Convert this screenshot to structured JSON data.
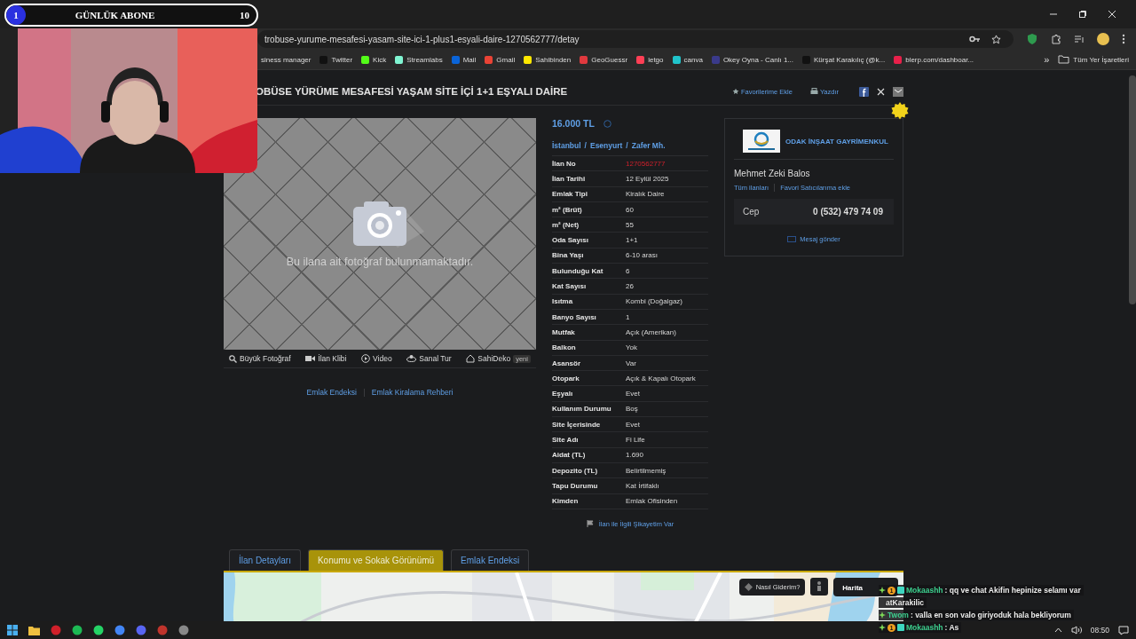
{
  "overlay": {
    "rank": "1",
    "label": "GÜNLÜK ABONE",
    "count": "10"
  },
  "browser": {
    "url": "trobuse-yurume-mesafesi-yasam-site-ici-1-plus1-esyali-daire-1270562777/detay",
    "bookmarks": [
      {
        "label": "siness manager",
        "icon": false
      },
      {
        "label": "Twitter",
        "icon": true
      },
      {
        "label": "Kick",
        "icon": true
      },
      {
        "label": "Streamlabs",
        "icon": true
      },
      {
        "label": "Mail",
        "icon": true
      },
      {
        "label": "Gmail",
        "icon": true
      },
      {
        "label": "Sahibinden",
        "icon": true
      },
      {
        "label": "GeoGuessr",
        "icon": true
      },
      {
        "label": "letgo",
        "icon": true
      },
      {
        "label": "canva",
        "icon": true
      },
      {
        "label": "Okey Oyna - Canlı 1...",
        "icon": true
      },
      {
        "label": "Kürşat Karakılıç (@k...",
        "icon": true
      },
      {
        "label": "blerp.com/dashboar...",
        "icon": true
      }
    ],
    "more": "»",
    "all_bookmarks": "Tüm Yer İşaretleri"
  },
  "listing": {
    "title": "OBÜSE YÜRÜME MESAFESİ YAŞAM SİTE İÇİ 1+1 EŞYALI DAİRE",
    "actions": [
      {
        "kind": "favorite",
        "label": "Favorilerime Ekle"
      },
      {
        "kind": "print",
        "label": "Yazdır"
      }
    ],
    "photo_message": "Bu ilana ait fotoğraf bulunmamaktadır.",
    "photo_tools": [
      {
        "kind": "zoom",
        "label": "Büyük Fotoğraf"
      },
      {
        "kind": "clip",
        "label": "İlan Klibi"
      },
      {
        "kind": "video",
        "label": "Video"
      },
      {
        "kind": "tour",
        "label": "Sanal Tur"
      },
      {
        "kind": "deko",
        "label": "SahiDeko",
        "badge": "yeni"
      }
    ],
    "links": [
      "Emlak Endeksi",
      "Emlak Kiralama Rehberi"
    ],
    "price": "16.000 TL",
    "breadcrumb": [
      "İstanbul",
      "Esenyurt",
      "Zafer Mh."
    ],
    "breadcrumb_separator": "/",
    "details": [
      {
        "kind": "id",
        "label": "İlan No",
        "value": "1270562777"
      },
      {
        "kind": "text",
        "label": "İlan Tarihi",
        "value": "12 Eylül 2025"
      },
      {
        "kind": "text",
        "label": "Emlak Tipi",
        "value": "Kiralık Daire"
      },
      {
        "kind": "text",
        "label": "m² (Brüt)",
        "value": "60"
      },
      {
        "kind": "text",
        "label": "m² (Net)",
        "value": "55"
      },
      {
        "kind": "text",
        "label": "Oda Sayısı",
        "value": "1+1"
      },
      {
        "kind": "text",
        "label": "Bina Yaşı",
        "value": "6-10 arası"
      },
      {
        "kind": "text",
        "label": "Bulunduğu Kat",
        "value": "6"
      },
      {
        "kind": "text",
        "label": "Kat Sayısı",
        "value": "26"
      },
      {
        "kind": "text",
        "label": "Isıtma",
        "value": "Kombi (Doğalgaz)"
      },
      {
        "kind": "text",
        "label": "Banyo Sayısı",
        "value": "1"
      },
      {
        "kind": "text",
        "label": "Mutfak",
        "value": "Açık (Amerikan)"
      },
      {
        "kind": "text",
        "label": "Balkon",
        "value": "Yok"
      },
      {
        "kind": "text",
        "label": "Asansör",
        "value": "Var"
      },
      {
        "kind": "text",
        "label": "Otopark",
        "value": "Açık & Kapalı Otopark"
      },
      {
        "kind": "text",
        "label": "Eşyalı",
        "value": "Evet"
      },
      {
        "kind": "text",
        "label": "Kullanım Durumu",
        "value": "Boş"
      },
      {
        "kind": "text",
        "label": "Site İçerisinde",
        "value": "Evet"
      },
      {
        "kind": "text",
        "label": "Site Adı",
        "value": "Fi Life"
      },
      {
        "kind": "text",
        "label": "Aidat (TL)",
        "value": "1.690"
      },
      {
        "kind": "text",
        "label": "Depozito (TL)",
        "value": "Belirtilmemiş"
      },
      {
        "kind": "text",
        "label": "Tapu Durumu",
        "value": "Kat İrtifaklı"
      },
      {
        "kind": "text",
        "label": "Kimden",
        "value": "Emlak Ofisinden"
      }
    ],
    "complaint": "İlan ile İlgili Şikayetim Var",
    "seller": {
      "company": "ODAK İNŞAAT GAYRİMENKUL",
      "name": "Mehmet Zeki Balos",
      "links": [
        "Tüm ilanları",
        "Favori Satıcılarıma ekle"
      ],
      "phone_label": "Cep",
      "phone": "0 (532) 479 74 09",
      "message": "Mesaj gönder"
    }
  },
  "tabs": [
    {
      "label": "İlan Detayları",
      "selected": false
    },
    {
      "label": "Konumu ve Sokak Görünümü",
      "selected": true
    },
    {
      "label": "Emlak Endeksi",
      "selected": false
    }
  ],
  "map": {
    "directions": "Nasıl Giderim?",
    "types": [
      {
        "label": "Harita",
        "selected": true
      }
    ]
  },
  "chat": [
    {
      "kind": "message",
      "badge": "1",
      "user": "Mokaashh",
      "text": ": qq ve chat Akifin hepinize selamı var"
    },
    {
      "kind": "continuation",
      "text": "atKarakilic"
    },
    {
      "kind": "message",
      "user": "Twom",
      "text": ": valla en son valo giriyoduk hala bekliyorum"
    },
    {
      "kind": "message",
      "badge": "1",
      "user": "Mokaashh",
      "text": ": As"
    }
  ],
  "taskbar": {
    "time": "08:50"
  }
}
